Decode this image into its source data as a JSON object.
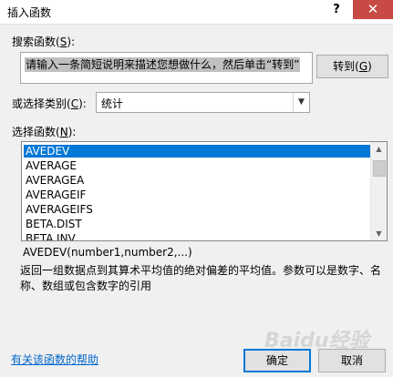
{
  "window": {
    "title": "插入函数",
    "help_label": "?",
    "close_label": "✕"
  },
  "search": {
    "label": "搜索函数",
    "mnemonic": "S",
    "value": "请输入一条简短说明来描述您想做什么，然后单击“转到”",
    "go_label": "转到",
    "go_mnemonic": "G"
  },
  "category": {
    "label": "或选择类别",
    "mnemonic": "C",
    "selected": "统计"
  },
  "function_list": {
    "label": "选择函数",
    "mnemonic": "N",
    "items": [
      "AVEDEV",
      "AVERAGE",
      "AVERAGEA",
      "AVERAGEIF",
      "AVERAGEIFS",
      "BETA.DIST",
      "BETA.INV"
    ],
    "selected_index": 0
  },
  "details": {
    "syntax": "AVEDEV(number1,number2,...)",
    "description": "返回一组数据点到其算术平均值的绝对偏差的平均值。参数可以是数字、名称、数组或包含数字的引用"
  },
  "footer": {
    "help_link": "有关该函数的帮助",
    "ok_label": "确定",
    "cancel_label": "取消"
  },
  "watermark": "Baidu经验",
  "colors": {
    "selection": "#0078d7",
    "close_button": "#c74a44",
    "link": "#0066cc"
  }
}
